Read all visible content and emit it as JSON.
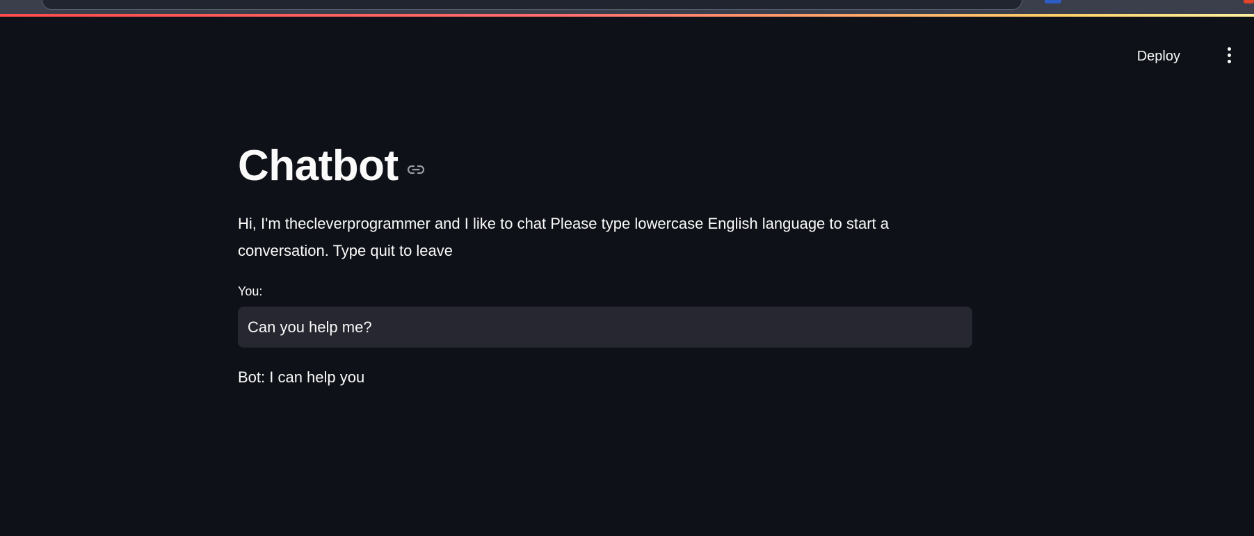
{
  "header": {
    "deploy_label": "Deploy"
  },
  "main": {
    "title": "Chatbot",
    "intro": "Hi, I'm thecleverprogrammer and I like to chat Please type lowercase English language to start a conversation. Type quit to leave",
    "input_label": "You:",
    "input_value": "Can you help me?",
    "bot_reply": "Bot: I can help you"
  },
  "icons": {
    "menu": "vertical-ellipsis-icon",
    "anchor": "link-icon"
  },
  "colors": {
    "background": "#0e1117",
    "text": "#fafafa",
    "input_bg": "#262730",
    "accent": "#ff4b4b"
  }
}
